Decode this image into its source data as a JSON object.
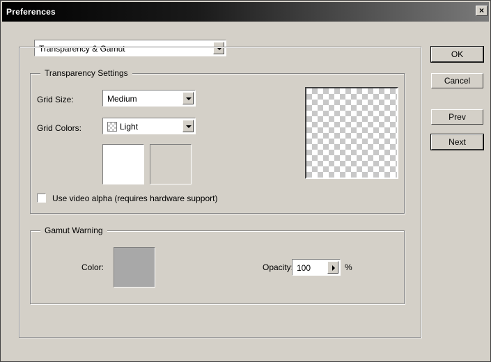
{
  "dialog": {
    "title": "Preferences",
    "close_glyph": "×",
    "section_select": "Transparency & Gamut"
  },
  "buttons": {
    "ok": "OK",
    "cancel": "Cancel",
    "prev": "Prev",
    "next": "Next"
  },
  "transparency": {
    "group_title": "Transparency Settings",
    "grid_size_label": "Grid Size:",
    "grid_size_value": "Medium",
    "grid_colors_label": "Grid Colors:",
    "grid_colors_value": "Light",
    "color1": "#ffffff",
    "color2": "#d4d0c8",
    "video_alpha_label": "Use video alpha (requires hardware support)",
    "video_alpha_checked": false
  },
  "gamut": {
    "group_title": "Gamut Warning",
    "color_label": "Color:",
    "color": "#a8a8a8",
    "opacity_label": "Opacity:",
    "opacity_value": "100",
    "opacity_unit": "%"
  }
}
